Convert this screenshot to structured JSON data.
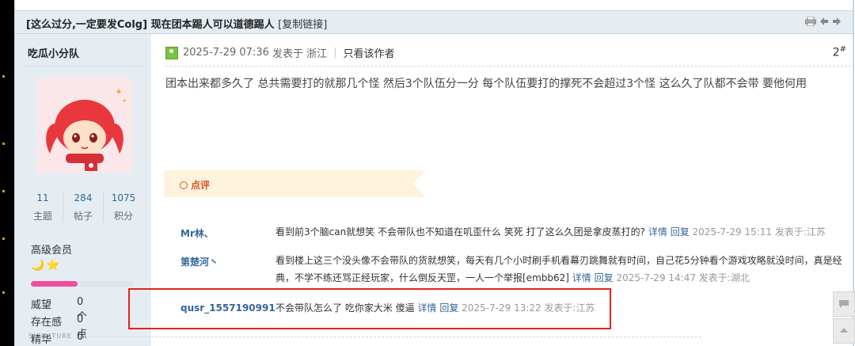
{
  "thread": {
    "title": "[这么过分,一定要发Colg] 现在团本踢人可以道德踢人",
    "copy_link": "[复制链接]"
  },
  "toolbar_icons": [
    "print-icon",
    "prev-arrow-icon",
    "next-arrow-icon"
  ],
  "author": {
    "name": "吃瓜小分队",
    "stats": [
      {
        "value": "11",
        "label": "主题"
      },
      {
        "value": "284",
        "label": "帖子"
      },
      {
        "value": "1075",
        "label": "积分"
      }
    ],
    "group": "高级会员",
    "stars": "🌙⭐",
    "credit_progress": 0.45,
    "profile": [
      {
        "label": "威望",
        "value": "0 个"
      },
      {
        "label": "存在感",
        "value": "0 点"
      },
      {
        "label": "精华",
        "value": "0"
      }
    ]
  },
  "post": {
    "date": "2025-7-29 07:36",
    "published_in": "发表于 浙江",
    "only_author": "只看该作者",
    "floor": "2",
    "floor_mark": "#",
    "body": "团本出来都多久了 总共需要打的就那几个怪 然后3个队伍分一分 每个队伍要打的撑死不会超过3个怪 这么久了队都不会带 要他何用"
  },
  "comments": {
    "label": "点评",
    "items": [
      {
        "user": "Mr林、",
        "text": "看到前3个脑can就想笑 不会带队也不知道在叽歪什么 笑死 打了这么久团是拿皮蒸打的?",
        "detail": "详情",
        "reply": "回复",
        "meta": "2025-7-29 15:11 发表于:江苏"
      },
      {
        "user": "第楚河丶",
        "text": "看到楼上这三个没头像不会带队的货就想笑，每天有几个小时刷手机看幕刃跳舞就有时间，自己花5分钟看个游戏攻略就没时间，真是经典，不学不练还骂正经玩家，什么倒反天罡，一人一个举报[embb62]",
        "detail": "详情",
        "reply": "回复",
        "meta": "2025-7-29 14:47 发表于:湖北"
      },
      {
        "user": "qusr_1557190991",
        "text": "不会带队怎么了 吃你家大米 傻逼",
        "detail": "详情",
        "reply": "回复",
        "meta": "2025-7-29 13:22 发表于:江苏"
      }
    ]
  },
  "signature_label": "SIGNATURE",
  "colors": {
    "link": "#336699",
    "header_bg": "#e5edf2",
    "highlight": "#e1231b",
    "comment_accent": "#d9531e"
  }
}
